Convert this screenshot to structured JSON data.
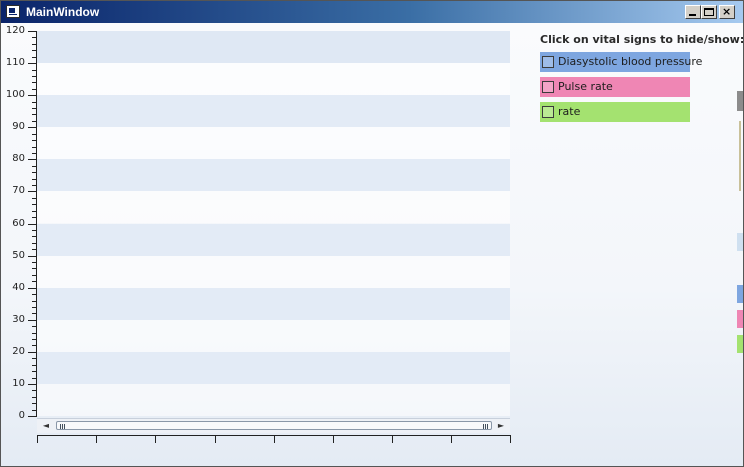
{
  "window": {
    "title": "MainWindow",
    "minimize_glyph": "",
    "maximize_glyph": "",
    "close_glyph": "×"
  },
  "legend": {
    "header": "Click on vital signs to hide/show:",
    "items": [
      {
        "label": "Diasystolic blood pressure",
        "color": "#7ea6e0",
        "checked": false
      },
      {
        "label": "Pulse rate",
        "color": "#ef86b4",
        "checked": false
      },
      {
        "label": "rate",
        "color": "#a4e270",
        "checked": false
      }
    ]
  },
  "chart_data": {
    "type": "line",
    "title": "",
    "xlabel": "",
    "ylabel": "",
    "ylim": [
      0,
      120
    ],
    "y_ticks": [
      "0",
      "10",
      "20",
      "30",
      "40",
      "50",
      "60",
      "70",
      "80",
      "90",
      "100",
      "110",
      "120"
    ],
    "series": [],
    "grid": "alternating horizontal bands"
  },
  "scrollbar": {
    "left_arrow": "◄",
    "right_arrow": "►"
  },
  "colors": {
    "band_light": "#f0f4fa",
    "band_dark": "#e3ebf6",
    "title_bar_start": "#0a246a",
    "title_bar_end": "#a6caf0"
  }
}
